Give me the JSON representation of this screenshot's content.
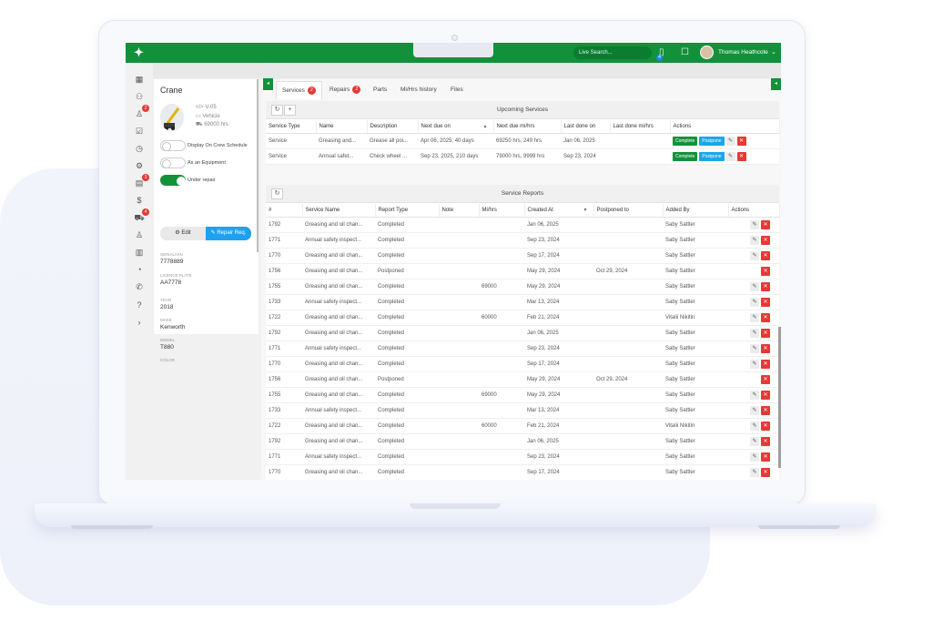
{
  "topbar": {
    "search_placeholder": "Live Search...",
    "notif_count": "4",
    "user_name": "Thomas Heathcote"
  },
  "rail_badges": {
    "users": "2",
    "calendar": "3",
    "truck": "4"
  },
  "crane": {
    "title": "Crane",
    "vin": "V-05",
    "type": "Vehicle",
    "hours": "69000 hrs",
    "toggles": [
      {
        "label": "Display On Crew Schedule",
        "on": false
      },
      {
        "label": "As an Equipment",
        "on": false
      },
      {
        "label": "Under repair",
        "on": true
      }
    ],
    "edit_label": "Edit",
    "repair_label": "Repair Req.",
    "fields": [
      {
        "label": "SERIAL/VIN",
        "value": "7778889"
      },
      {
        "label": "LICENCE PLATE",
        "value": "AA7778"
      },
      {
        "label": "YEAR",
        "value": "2018"
      },
      {
        "label": "MAKE",
        "value": "Kenworth"
      },
      {
        "label": "MODEL",
        "value": "T880"
      },
      {
        "label": "COLOR",
        "value": ""
      }
    ]
  },
  "tabs": [
    {
      "label": "Services",
      "badge": "2"
    },
    {
      "label": "Repairs",
      "badge": "2"
    },
    {
      "label": "Parts",
      "badge": ""
    },
    {
      "label": "Mi/Hrs history",
      "badge": ""
    },
    {
      "label": "Files",
      "badge": ""
    }
  ],
  "upcoming": {
    "title": "Upcoming Services",
    "columns": [
      "Service Type",
      "Name",
      "Description",
      "Next due on",
      "Next due mi/hrs",
      "Last done on",
      "Last done mi/hrs",
      "Actions"
    ],
    "complete_label": "Complete",
    "postpone_label": "Postpone",
    "rows": [
      [
        "Service",
        "Greasing and...",
        "Grease all poi...",
        "Apr 06, 2025, 40 days",
        "69250 hrs, 249 hrs",
        "Jan 06, 2025",
        ""
      ],
      [
        "Service",
        "Annual safet...",
        "Check wheel ...",
        "Sep 23, 2025, 210 days",
        "79000 hrs, 9999 hrs",
        "Sep 23, 2024",
        ""
      ]
    ]
  },
  "reports": {
    "title": "Service Reports",
    "columns": [
      "#",
      "Service Name",
      "Report Type",
      "Note",
      "Mi/hrs",
      "Created At",
      "Postponed to",
      "Added By",
      "Actions"
    ],
    "rows": [
      [
        "1792",
        "Greasing and oil chan...",
        "Completed",
        "",
        "",
        "Jan 06, 2025",
        "",
        "Saby Sattler",
        "edit"
      ],
      [
        "1771",
        "Annual safety inspect...",
        "Completed",
        "",
        "",
        "Sep 23, 2024",
        "",
        "Saby Sattler",
        "edit"
      ],
      [
        "1770",
        "Greasing and oil chan...",
        "Completed",
        "",
        "",
        "Sep 17, 2024",
        "",
        "Saby Sattler",
        "edit"
      ],
      [
        "1756",
        "Greasing and oil chan...",
        "Postponed",
        "",
        "",
        "May 29, 2024",
        "Oct 29, 2024",
        "Saby Sattler",
        "del"
      ],
      [
        "1755",
        "Greasing and oil chan...",
        "Completed",
        "",
        "69000",
        "May 29, 2024",
        "",
        "Saby Sattler",
        "edit"
      ],
      [
        "1733",
        "Annual safety inspect...",
        "Completed",
        "",
        "",
        "Mar 13, 2024",
        "",
        "Saby Sattler",
        "edit"
      ],
      [
        "1722",
        "Greasing and oil chan...",
        "Completed",
        "",
        "60000",
        "Feb 21, 2024",
        "",
        "Vitalii Nikitin",
        "edit"
      ],
      [
        "1792",
        "Greasing and oil chan...",
        "Completed",
        "",
        "",
        "Jan 06, 2025",
        "",
        "Saby Sattler",
        "edit"
      ],
      [
        "1771",
        "Annual safety inspect...",
        "Completed",
        "",
        "",
        "Sep 23, 2024",
        "",
        "Saby Sattler",
        "edit"
      ],
      [
        "1770",
        "Greasing and oil chan...",
        "Completed",
        "",
        "",
        "Sep 17, 2024",
        "",
        "Saby Sattler",
        "edit"
      ],
      [
        "1756",
        "Greasing and oil chan...",
        "Postponed",
        "",
        "",
        "May 29, 2024",
        "Oct 29, 2024",
        "Saby Sattler",
        "del"
      ],
      [
        "1755",
        "Greasing and oil chan...",
        "Completed",
        "",
        "69000",
        "May 29, 2024",
        "",
        "Saby Sattler",
        "edit"
      ],
      [
        "1733",
        "Annual safety inspect...",
        "Completed",
        "",
        "",
        "Mar 13, 2024",
        "",
        "Saby Sattler",
        "edit"
      ],
      [
        "1722",
        "Greasing and oil chan...",
        "Completed",
        "",
        "60000",
        "Feb 21, 2024",
        "",
        "Vitalii Nikitin",
        "edit"
      ],
      [
        "1792",
        "Greasing and oil chan...",
        "Completed",
        "",
        "",
        "Jan 06, 2025",
        "",
        "Saby Sattler",
        "edit"
      ],
      [
        "1771",
        "Annual safety inspect...",
        "Completed",
        "",
        "",
        "Sep 23, 2024",
        "",
        "Saby Sattler",
        "edit"
      ],
      [
        "1770",
        "Greasing and oil chan...",
        "Completed",
        "",
        "",
        "Sep 17, 2024",
        "",
        "Saby Sattler",
        "edit"
      ]
    ]
  }
}
